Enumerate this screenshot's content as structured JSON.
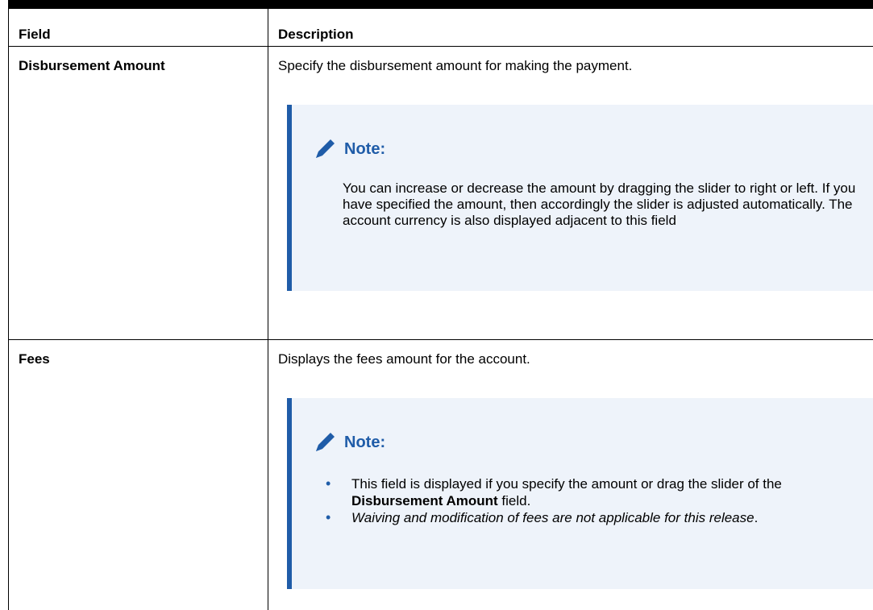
{
  "table": {
    "headers": {
      "field": "Field",
      "description": "Description"
    },
    "rows": [
      {
        "field": "Disbursement Amount",
        "description": "Specify the disbursement amount for making the payment.",
        "note": {
          "title": "Note:",
          "text": "You can increase or decrease the amount by dragging the slider to right or left. If you have specified the amount, then accordingly the slider is adjusted automatically. The account currency is also displayed adjacent to this field"
        }
      },
      {
        "field": "Fees",
        "description": "Displays the fees amount for the account.",
        "note": {
          "title": "Note:",
          "bullets": [
            {
              "before": "This field is displayed if you specify the amount or drag the slider of the ",
              "bold": "Disbursement Amount",
              "after": " field."
            },
            {
              "italic": "Waiving and modification of fees are not applicable for this release",
              "after": "."
            }
          ]
        }
      }
    ]
  },
  "colors": {
    "note_accent": "#1f5ca8",
    "note_background": "#eef3fa"
  },
  "icons": {
    "note_icon": "pencil-icon"
  }
}
